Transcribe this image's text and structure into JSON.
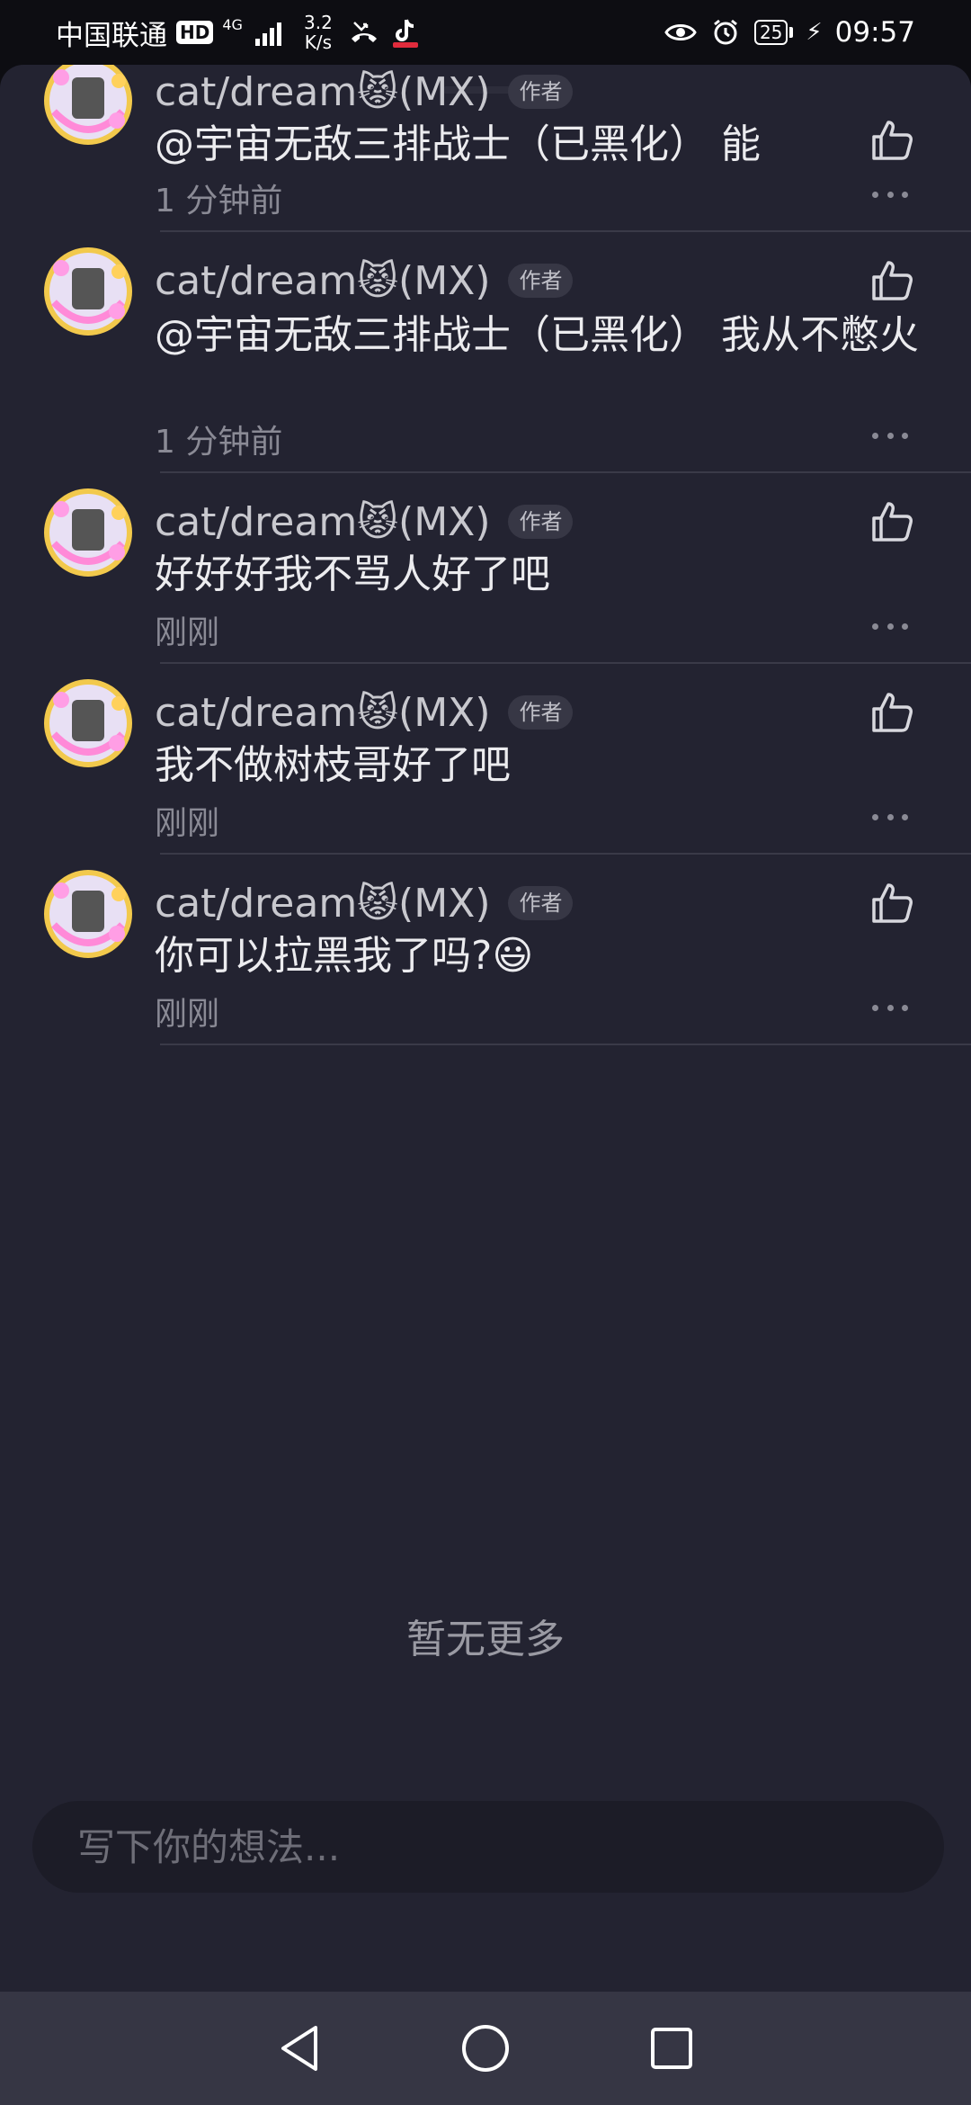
{
  "status_bar": {
    "carrier": "中国联通",
    "hd": "HD",
    "network": "4G",
    "speed_value": "3.2",
    "speed_unit": "K/s",
    "battery": "25",
    "time": "09:57"
  },
  "comments": [
    {
      "name": "cat/dream😾(MX)",
      "badge": "作者",
      "text": "@宇宙无敌三排战士（已黑化） 能",
      "time": "1 分钟前"
    },
    {
      "name": "cat/dream😾(MX)",
      "badge": "作者",
      "text": "@宇宙无敌三排战士（已黑化） 我从不憋火",
      "time": "1 分钟前"
    },
    {
      "name": "cat/dream😾(MX)",
      "badge": "作者",
      "text": "好好好我不骂人好了吧",
      "time": "刚刚"
    },
    {
      "name": "cat/dream😾(MX)",
      "badge": "作者",
      "text": "我不做树枝哥好了吧",
      "time": "刚刚"
    },
    {
      "name": "cat/dream😾(MX)",
      "badge": "作者",
      "text": "你可以拉黑我了吗?😃",
      "time": "刚刚"
    }
  ],
  "footer": {
    "no_more": "暂无更多"
  },
  "input": {
    "placeholder": "写下你的想法..."
  },
  "colors": {
    "sheet_bg": "#232331",
    "status_bg": "#0d0d12",
    "nav_bg": "#363644"
  }
}
